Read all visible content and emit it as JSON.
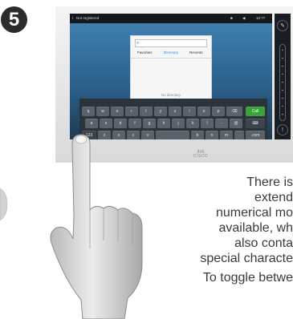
{
  "step": {
    "number": "5"
  },
  "status_bar": {
    "left": "Not registered",
    "time": "12:??"
  },
  "directory": {
    "search_placeholder": "",
    "tabs": [
      "Favorites",
      "Directory",
      "Recents"
    ],
    "active_tab": "Directory",
    "empty_text": "No directory"
  },
  "keyboard": {
    "row1": [
      "q",
      "w",
      "e",
      "r",
      "t",
      "y",
      "u",
      "i",
      "o",
      "p",
      "⌫"
    ],
    "enter": "Call",
    "row2": [
      "a",
      "s",
      "d",
      "f",
      "g",
      "h",
      "j",
      "k",
      "l",
      "-",
      "@"
    ],
    "row3": [
      "123",
      "z",
      "x",
      "c",
      "v",
      "",
      "b",
      "n",
      "m",
      ".",
      ".com"
    ]
  },
  "brand": {
    "logo_text": "CISCO"
  },
  "instructions": {
    "lines": [
      "There is",
      "extend",
      "numerical mo",
      "available, wh",
      "also conta",
      "special characte"
    ],
    "toggle_line": "To toggle betwe"
  },
  "colors": {
    "accent_blue": "#1e88e5",
    "call_green": "#3aa33a",
    "screen_blue": "#3e7fb0"
  }
}
